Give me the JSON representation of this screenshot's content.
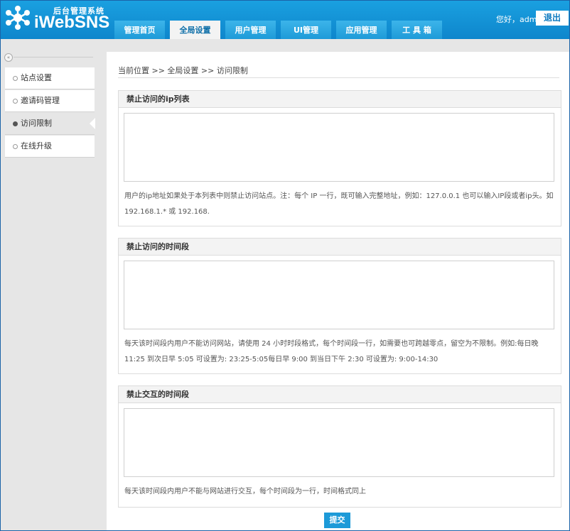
{
  "header": {
    "logo_subtitle": "后台管理系统",
    "logo_title": "iWebSNS",
    "greeting": "您好，admin",
    "logout_label": "退出"
  },
  "nav": {
    "tabs": [
      {
        "label": "管理首页",
        "active": false
      },
      {
        "label": "全局设置",
        "active": true
      },
      {
        "label": "用户管理",
        "active": false
      },
      {
        "label": "UI管理",
        "active": false
      },
      {
        "label": "应用管理",
        "active": false
      },
      {
        "label": "工 具 箱",
        "active": false
      }
    ]
  },
  "sidebar": {
    "collapse_glyph": "«",
    "items": [
      {
        "label": "站点设置",
        "active": false
      },
      {
        "label": "邀请码管理",
        "active": false
      },
      {
        "label": "访问限制",
        "active": true
      },
      {
        "label": "在线升级",
        "active": false
      }
    ]
  },
  "breadcrumb": "当前位置 >> 全局设置 >> 访问限制",
  "sections": [
    {
      "title": "禁止访问的ip列表",
      "value": "",
      "note": "用户的ip地址如果处于本列表中则禁止访问站点。注：每个 IP 一行，既可输入完整地址，例如：127.0.0.1 也可以输入IP段或者ip头。如 192.168.1.* 或 192.168."
    },
    {
      "title": "禁止访问的时间段",
      "value": "",
      "note": "每天该时间段内用户不能访问网站，请使用 24 小时时段格式，每个时间段一行，如需要也可跨越零点，留空为不限制。例如:每日晚 11:25 到次日早 5:05 可设置为: 23:25-5:05每日早 9:00 到当日下午 2:30 可设置为: 9:00-14:30"
    },
    {
      "title": "禁止交互的时间段",
      "value": "",
      "note": "每天该时间段内用户不能与网站进行交互，每个时间段为一行，时间格式同上"
    }
  ],
  "submit_label": "提交",
  "colors": {
    "header_blue": "#0e86cc",
    "tab_blue": "#1e9bd8",
    "button_blue": "#1d9ad8"
  },
  "icons": {
    "logo": "people-network-icon",
    "collapse": "double-chevron-left-icon",
    "radio": "radio-dot-icon"
  }
}
